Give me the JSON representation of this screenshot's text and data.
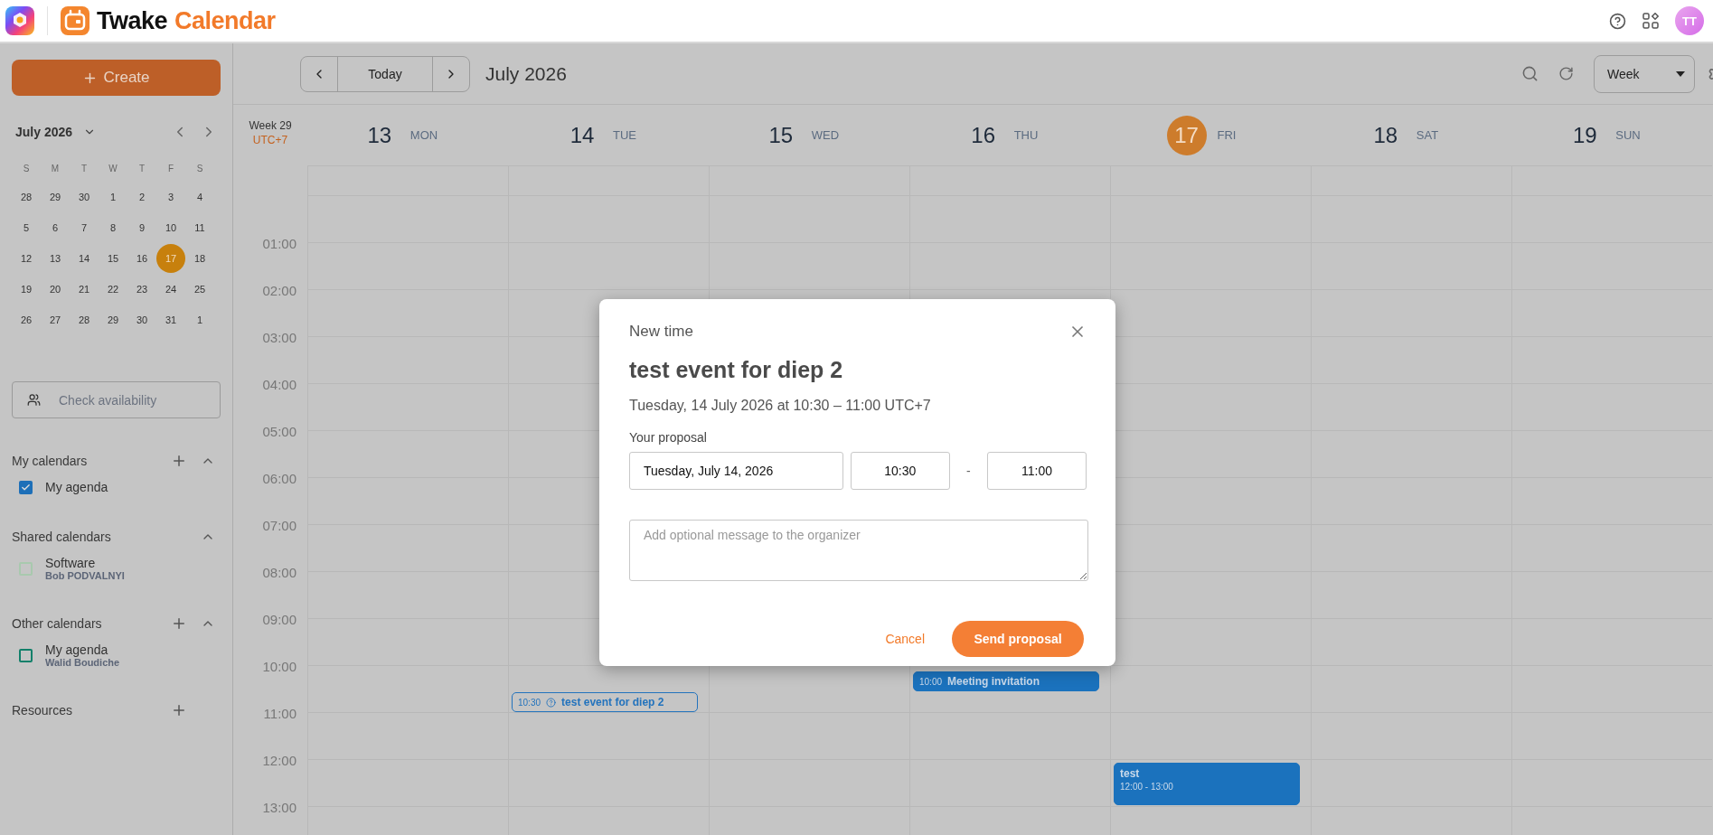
{
  "app_header": {
    "brand_name": "Twake",
    "brand_product": "Calendar",
    "avatar_initials": "TT"
  },
  "sidebar": {
    "create_button": "Create",
    "mini_calendar": {
      "title": "July 2026",
      "weekdays": [
        "S",
        "M",
        "T",
        "W",
        "T",
        "F",
        "S"
      ],
      "weeks": [
        [
          {
            "day": "28",
            "selected": false
          },
          {
            "day": "29",
            "selected": false
          },
          {
            "day": "30",
            "selected": false
          },
          {
            "day": "1",
            "selected": false
          },
          {
            "day": "2",
            "selected": false
          },
          {
            "day": "3",
            "selected": false
          },
          {
            "day": "4",
            "selected": false
          }
        ],
        [
          {
            "day": "5",
            "selected": false
          },
          {
            "day": "6",
            "selected": false
          },
          {
            "day": "7",
            "selected": false
          },
          {
            "day": "8",
            "selected": false
          },
          {
            "day": "9",
            "selected": false
          },
          {
            "day": "10",
            "selected": false
          },
          {
            "day": "11",
            "selected": false
          }
        ],
        [
          {
            "day": "12",
            "selected": false
          },
          {
            "day": "13",
            "selected": false
          },
          {
            "day": "14",
            "selected": false
          },
          {
            "day": "15",
            "selected": false
          },
          {
            "day": "16",
            "selected": false
          },
          {
            "day": "17",
            "selected": true
          },
          {
            "day": "18",
            "selected": false
          }
        ],
        [
          {
            "day": "19",
            "selected": false
          },
          {
            "day": "20",
            "selected": false
          },
          {
            "day": "21",
            "selected": false
          },
          {
            "day": "22",
            "selected": false
          },
          {
            "day": "23",
            "selected": false
          },
          {
            "day": "24",
            "selected": false
          },
          {
            "day": "25",
            "selected": false
          }
        ],
        [
          {
            "day": "26",
            "selected": false
          },
          {
            "day": "27",
            "selected": false
          },
          {
            "day": "28",
            "selected": false
          },
          {
            "day": "29",
            "selected": false
          },
          {
            "day": "30",
            "selected": false
          },
          {
            "day": "31",
            "selected": false
          },
          {
            "day": "1",
            "selected": false
          }
        ]
      ]
    },
    "check_availability": "Check availability",
    "sections": [
      {
        "title": "My calendars",
        "can_add": true,
        "expanded": true,
        "calendars": [
          {
            "name": "My agenda",
            "checked": true,
            "color": "#1d6fb8"
          }
        ]
      },
      {
        "title": "Shared calendars",
        "can_add": false,
        "expanded": true,
        "calendars": [
          {
            "name": "Software",
            "owner": "Bob PODVALNYI",
            "checked": false,
            "color": "#a8c9ae"
          }
        ]
      },
      {
        "title": "Other calendars",
        "can_add": true,
        "expanded": true,
        "calendars": [
          {
            "name": "My agenda",
            "owner": "Walid Boudiche",
            "checked": false,
            "color": "#12806a"
          }
        ]
      },
      {
        "title": "Resources",
        "can_add": true
      }
    ]
  },
  "toolbar": {
    "today_button": "Today",
    "period_title": "July 2026",
    "view_select": "Week"
  },
  "week_header": {
    "week_label": "Week 29",
    "timezone": "UTC+7"
  },
  "days": [
    {
      "number": "13",
      "weekday": "MON",
      "selected": false
    },
    {
      "number": "14",
      "weekday": "TUE",
      "selected": false,
      "events": [
        {
          "kind": "pending",
          "time": "10:30",
          "title": "test event for diep 2"
        }
      ]
    },
    {
      "number": "15",
      "weekday": "WED",
      "selected": false
    },
    {
      "number": "16",
      "weekday": "THU",
      "selected": false,
      "events": [
        {
          "kind": "inline",
          "time": "10:00",
          "title": "Meeting invitation"
        }
      ]
    },
    {
      "number": "17",
      "weekday": "FRI",
      "selected": true,
      "events": [
        {
          "kind": "block",
          "time": "12:00 - 13:00",
          "title": "test"
        }
      ]
    },
    {
      "number": "18",
      "weekday": "SAT",
      "selected": false
    },
    {
      "number": "19",
      "weekday": "SUN",
      "selected": false
    }
  ],
  "hours": [
    "01:00",
    "02:00",
    "03:00",
    "04:00",
    "05:00",
    "06:00",
    "07:00",
    "08:00",
    "09:00",
    "10:00",
    "11:00",
    "12:00",
    "13:00"
  ],
  "dialog": {
    "heading": "New time",
    "event_title": "test event for diep 2",
    "event_when": "Tuesday, 14 July 2026 at 10:30 – 11:00 UTC+7",
    "proposal_label": "Your proposal",
    "date_value": "Tuesday, July 14, 2026",
    "start_value": "10:30",
    "separator": "-",
    "end_value": "11:00",
    "message_placeholder": "Add optional message to the organizer",
    "cancel_button": "Cancel",
    "submit_button": "Send proposal"
  }
}
